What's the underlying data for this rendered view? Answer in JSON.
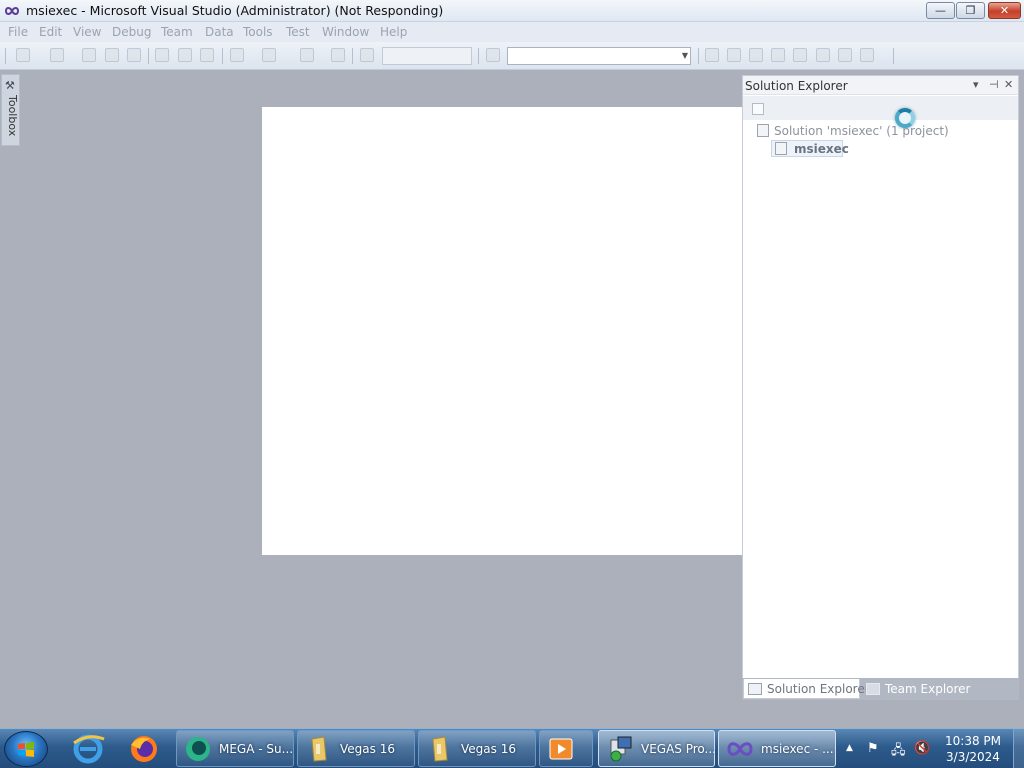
{
  "window": {
    "title": "msiexec - Microsoft Visual Studio (Administrator) (Not Responding)",
    "buttons": {
      "minimize": "—",
      "maximize": "❐",
      "close": "✕"
    }
  },
  "menu": [
    "File",
    "Edit",
    "View",
    "Debug",
    "Team",
    "Data",
    "Tools",
    "Test",
    "Window",
    "Help"
  ],
  "toolbox": {
    "label": "Toolbox"
  },
  "solution_explorer": {
    "title": "Solution Explorer",
    "header_buttons": {
      "dropdown": "▾",
      "pin": "⊣",
      "close": "✕"
    },
    "tree": {
      "solution": "Solution 'msiexec' (1 project)",
      "project": "msiexec"
    }
  },
  "bottom_tabs": [
    "Solution Explorer",
    "Team Explorer"
  ],
  "taskbar": {
    "items": [
      "MEGA - Su...",
      "Vegas 16",
      "Vegas 16",
      "VEGAS Pro...",
      "msiexec - ..."
    ],
    "clock": {
      "time": "10:38 PM",
      "date": "3/3/2024"
    }
  },
  "colors": {
    "workspace": "#abb0bb",
    "taskbar": "#2d5b8c",
    "close_button": "#c4402b",
    "spinner": "#4aa8c8"
  }
}
